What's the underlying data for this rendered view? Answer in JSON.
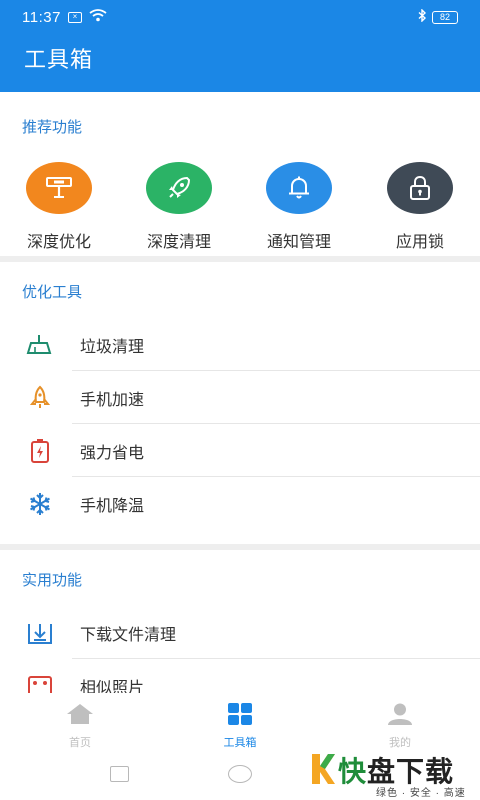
{
  "status_bar": {
    "time": "11:37",
    "notif_glyph": "×",
    "battery": "82",
    "wifi_icon": "wifi-icon",
    "bluetooth_icon": "bluetooth-icon"
  },
  "header": {
    "title": "工具箱"
  },
  "recommended": {
    "title": "推荐功能",
    "items": [
      {
        "label": "深度优化",
        "icon": "sign-icon",
        "color": "#f2871e"
      },
      {
        "label": "深度清理",
        "icon": "rocket-icon",
        "color": "#2bb366"
      },
      {
        "label": "通知管理",
        "icon": "bell-icon",
        "color": "#2a8ee6"
      },
      {
        "label": "应用锁",
        "icon": "lock-icon",
        "color": "#3f4a56"
      }
    ]
  },
  "optimize": {
    "title": "优化工具",
    "items": [
      {
        "label": "垃圾清理",
        "icon": "sweeper-icon",
        "color": "#1e8c6e"
      },
      {
        "label": "手机加速",
        "icon": "rocket-icon",
        "color": "#e6912a"
      },
      {
        "label": "强力省电",
        "icon": "battery-bolt-icon",
        "color": "#d9443a"
      },
      {
        "label": "手机降温",
        "icon": "snowflake-icon",
        "color": "#2a7fd0"
      }
    ]
  },
  "utility": {
    "title": "实用功能",
    "items": [
      {
        "label": "下载文件清理",
        "icon": "download-icon",
        "color": "#2a7fd0"
      },
      {
        "label": "相似照片",
        "icon": "photo-icon",
        "color": "#d9443a"
      }
    ]
  },
  "bottom_nav": [
    {
      "label": "首页",
      "icon": "home-icon",
      "active": false
    },
    {
      "label": "工具箱",
      "icon": "grid-icon",
      "active": true
    },
    {
      "label": "我的",
      "icon": "user-icon",
      "active": false
    }
  ],
  "watermark": {
    "brand_a": "快",
    "brand_b": "盘下载",
    "tagline": "绿色 · 安全 · 高速"
  },
  "colors": {
    "accent": "#1b87e6",
    "section_title": "#2a7fd0",
    "nav_active": "#1b87e6",
    "nav_inactive": "#bfbfbf"
  }
}
